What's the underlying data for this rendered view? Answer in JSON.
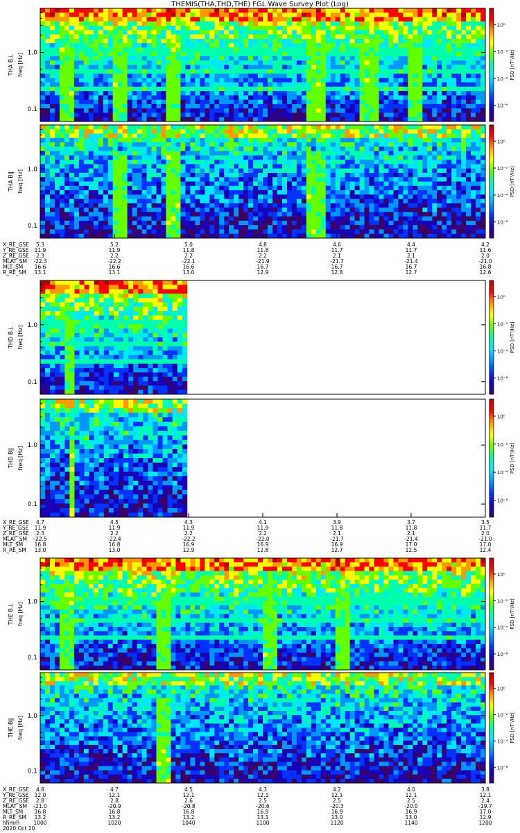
{
  "title": "THEMIS(THA,THD,THE) FGL Wave Survey Plot (Log)",
  "colorscale": {
    "label": "PSD [nT²/Hz]",
    "ticks": [
      "10⁰",
      "10⁻²",
      "10⁻⁴",
      "10⁻⁶"
    ],
    "colors": [
      "#3a0066",
      "#1a00b4",
      "#0032ff",
      "#0096ff",
      "#00e6ff",
      "#00ffaa",
      "#66ff00",
      "#ffff00",
      "#ff9900",
      "#ff0000",
      "#b30000"
    ]
  },
  "chart_data": [
    {
      "type": "heatmap",
      "probe": "THA",
      "panels": [
        {
          "ylabel": "THA B⊥",
          "yunit": "freq [Hz]",
          "yticks": [
            "1.0",
            "0.1"
          ],
          "log_y": true,
          "ylim": [
            0.06,
            6.0
          ],
          "streaks_x_fraction": [
            0.06,
            0.18,
            0.3,
            0.62,
            0.74,
            0.84
          ]
        },
        {
          "ylabel": "THA B‖",
          "yunit": "freq [Hz]",
          "yticks": [
            "1.0",
            "0.1"
          ],
          "log_y": true,
          "ylim": [
            0.06,
            6.0
          ],
          "streaks_x_fraction": [
            0.18,
            0.3,
            0.62
          ]
        }
      ],
      "ephemeris": [
        {
          "label": "X_RE_GSE",
          "values": [
            "5.3",
            "5.2",
            "5.0",
            "4.8",
            "4.6",
            "4.4",
            "4.2"
          ]
        },
        {
          "label": "Y_RE_GSE",
          "values": [
            "11.9",
            "11.9",
            "11.8",
            "11.8",
            "11.7",
            "11.7",
            "11.6"
          ]
        },
        {
          "label": "Z_RE_GSE",
          "values": [
            "2.3",
            "2.2",
            "2.2",
            "2.2",
            "2.1",
            "2.1",
            "2.0"
          ]
        },
        {
          "label": "MLAT_SM",
          "values": [
            "-22.3",
            "-22.2",
            "-22.1",
            "-21.9",
            "-21.7",
            "-21.4",
            "-21.0"
          ]
        },
        {
          "label": "MLT_SM",
          "values": [
            "16.6",
            "16.6",
            "16.6",
            "16.7",
            "16.7",
            "16.7",
            "16.8"
          ]
        },
        {
          "label": "R_RE_SM",
          "values": [
            "13.1",
            "13.1",
            "13.0",
            "12.9",
            "12.8",
            "12.7",
            "12.6"
          ]
        }
      ]
    },
    {
      "type": "heatmap",
      "probe": "THD",
      "data_coverage_fraction": 0.33,
      "panels": [
        {
          "ylabel": "THD B⊥",
          "yunit": "freq [Hz]",
          "yticks": [
            "1.0",
            "0.1"
          ],
          "log_y": true,
          "ylim": [
            0.06,
            6.0
          ],
          "streaks_x_fraction": [
            0.17,
            0.23
          ]
        },
        {
          "ylabel": "THD B‖",
          "yunit": "freq [Hz]",
          "yticks": [
            "1.0",
            "0.1"
          ],
          "log_y": true,
          "ylim": [
            0.06,
            6.0
          ],
          "streaks_x_fraction": [
            0.23
          ]
        }
      ],
      "ephemeris": [
        {
          "label": "X_RE_GSE",
          "values": [
            "4.7",
            "4.5",
            "4.3",
            "4.1",
            "3.9",
            "3.7",
            "3.5"
          ]
        },
        {
          "label": "Y_RE_GSE",
          "values": [
            "11.9",
            "11.9",
            "11.9",
            "11.9",
            "11.8",
            "11.8",
            "11.7"
          ]
        },
        {
          "label": "Z_RE_GSE",
          "values": [
            "2.3",
            "2.2",
            "2.2",
            "2.2",
            "2.1",
            "2.1",
            "2.0"
          ]
        },
        {
          "label": "MLAT_SM",
          "values": [
            "-22.5",
            "-22.4",
            "-22.2",
            "-22.0",
            "-21.7",
            "-21.4",
            "-21.0"
          ]
        },
        {
          "label": "MLT_SM",
          "values": [
            "16.8",
            "16.8",
            "16.9",
            "16.9",
            "16.9",
            "17.0",
            "17.0"
          ]
        },
        {
          "label": "R_RE_SM",
          "values": [
            "13.0",
            "13.0",
            "12.9",
            "12.8",
            "12.7",
            "12.5",
            "12.4"
          ]
        }
      ]
    },
    {
      "type": "heatmap",
      "probe": "THE",
      "panels": [
        {
          "ylabel": "THE B⊥",
          "yunit": "freq [Hz]",
          "yticks": [
            "1.0",
            "0.1"
          ],
          "log_y": true,
          "ylim": [
            0.06,
            6.0
          ],
          "streaks_x_fraction": [
            0.06,
            0.28,
            0.52,
            0.68
          ]
        },
        {
          "ylabel": "THE B‖",
          "yunit": "freq [Hz]",
          "yticks": [
            "1.0",
            "0.1"
          ],
          "log_y": true,
          "ylim": [
            0.06,
            6.0
          ],
          "streaks_x_fraction": [
            0.28
          ]
        }
      ],
      "ephemeris": [
        {
          "label": "X_RE_GSE",
          "values": [
            "4.8",
            "4.7",
            "4.5",
            "4.3",
            "4.2",
            "4.0",
            "3.8"
          ]
        },
        {
          "label": "Y_RE_GSE",
          "values": [
            "12.0",
            "12.1",
            "12.1",
            "12.1",
            "12.1",
            "12.1",
            "12.1"
          ]
        },
        {
          "label": "Z_RE_GSE",
          "values": [
            "2.8",
            "2.8",
            "2.6",
            "2.5",
            "2.5",
            "2.5",
            "2.4"
          ]
        },
        {
          "label": "MLAT_SM",
          "values": [
            "-21.0",
            "-20.9",
            "-20.8",
            "-20.6",
            "-20.3",
            "-20.0",
            "-19.7"
          ]
        },
        {
          "label": "MLT_SM",
          "values": [
            "16.8",
            "16.8",
            "16.8",
            "16.9",
            "16.9",
            "16.9",
            "17.0"
          ]
        },
        {
          "label": "R_RE_SM",
          "values": [
            "13.2",
            "13.2",
            "13.2",
            "13.1",
            "13.0",
            "13.0",
            "12.9"
          ]
        },
        {
          "label": "hhmm",
          "values": [
            "1000",
            "1020",
            "1040",
            "1100",
            "1120",
            "1140",
            "1200"
          ]
        }
      ],
      "date": "2020 Oct 20"
    }
  ]
}
